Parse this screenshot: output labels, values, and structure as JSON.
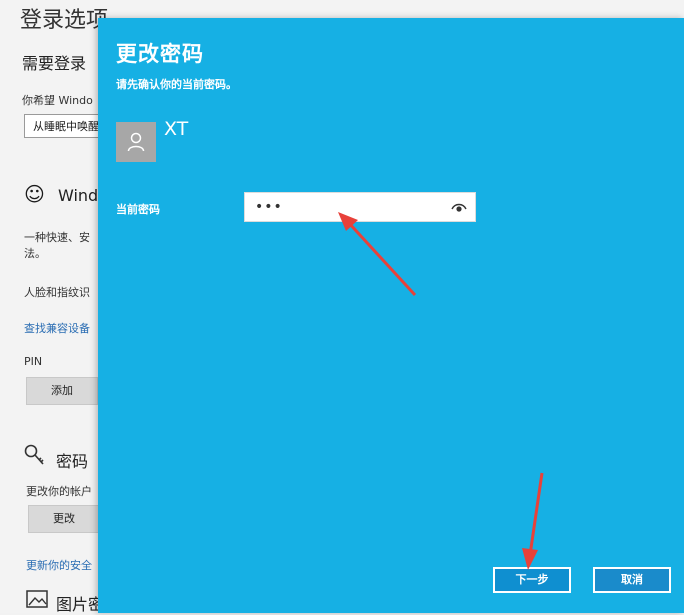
{
  "background": {
    "page_title": "登录选项",
    "require_signin_title": "需要登录",
    "require_signin_desc": "你希望 Windo",
    "dropdown_value": "从睡眠中唤醒",
    "windows_hello_title": "Wind",
    "windows_hello_desc_1": "一种快速、安",
    "windows_hello_desc_2": "法。",
    "face_fingerprint_text": "人脸和指纹识",
    "find_devices_link": "查找兼容设备",
    "pin_label": "PIN",
    "pin_add_button": "添加",
    "password_title": "密码",
    "password_desc": "更改你的帐户",
    "password_change_button": "更改",
    "security_link": "更新你的安全",
    "picture_password_title": "图片密"
  },
  "dialog": {
    "title": "更改密码",
    "subtitle": "请先确认你的当前密码。",
    "username": "XT",
    "password_label": "当前密码",
    "password_value": "•••",
    "next_button": "下一步",
    "cancel_button": "取消"
  },
  "colors": {
    "dialog_bg": "#16b0e4",
    "arrow": "#e8413a",
    "link": "#2a6db3"
  }
}
